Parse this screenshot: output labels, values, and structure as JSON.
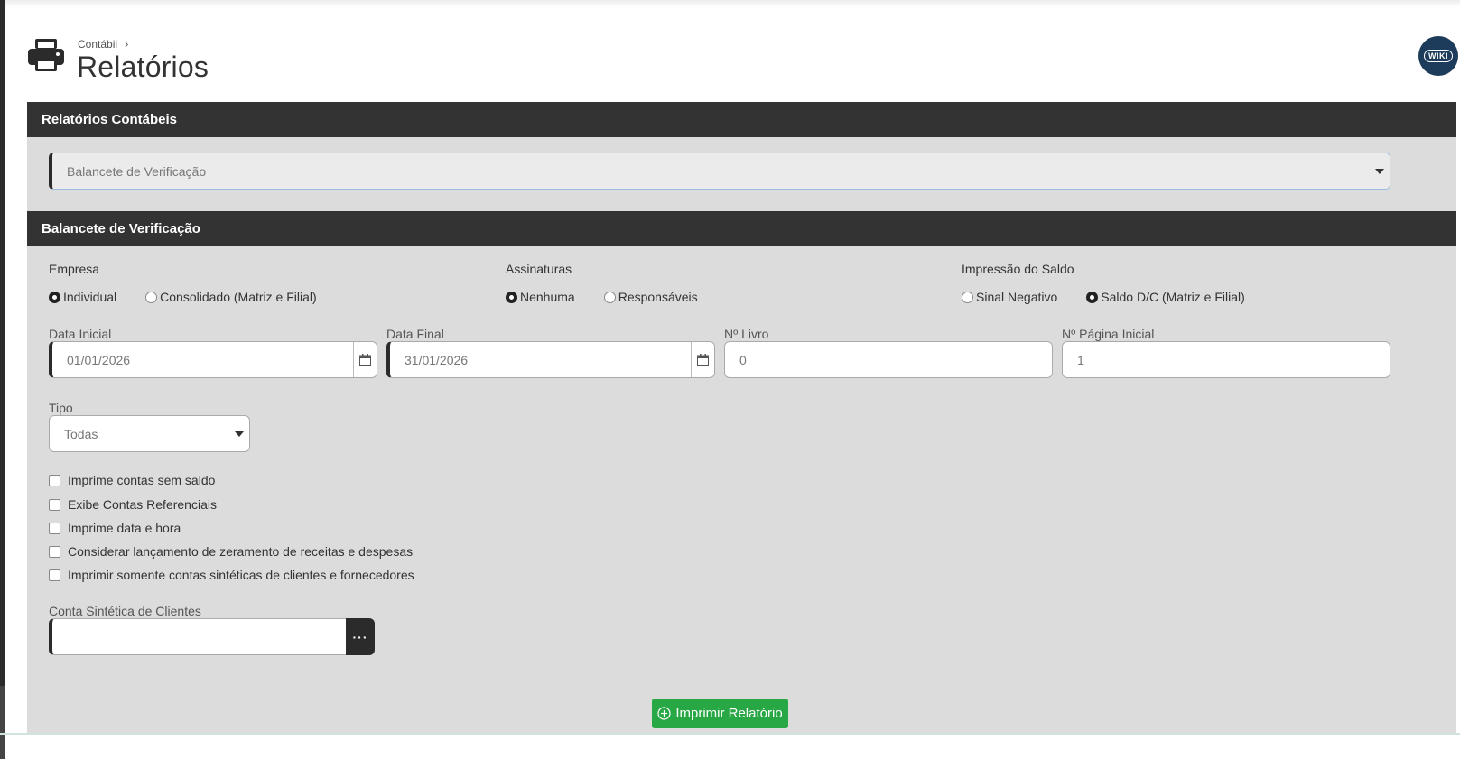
{
  "breadcrumb": {
    "parent": "Contábil"
  },
  "page": {
    "title": "Relatórios",
    "wiki_badge": "WIKI"
  },
  "report_section": {
    "title": "Relatórios Contábeis",
    "selected_report": "Balancete de Verificação"
  },
  "balancete": {
    "title": "Balancete de Verificação",
    "empresa": {
      "label": "Empresa",
      "options": [
        "Individual",
        "Consolidado (Matriz e Filial)"
      ],
      "selected": "Individual"
    },
    "assinaturas": {
      "label": "Assinaturas",
      "options": [
        "Nenhuma",
        "Responsáveis"
      ],
      "selected": "Nenhuma"
    },
    "impressao_saldo": {
      "label": "Impressão do Saldo",
      "options": [
        "Sinal Negativo",
        "Saldo D/C (Matriz e Filial)"
      ],
      "selected": "Saldo D/C (Matriz e Filial)"
    },
    "data_inicial": {
      "label": "Data Inicial",
      "value": "01/01/2026"
    },
    "data_final": {
      "label": "Data Final",
      "value": "31/01/2026"
    },
    "n_livro": {
      "label": "Nº Livro",
      "value": "0"
    },
    "n_pagina_inicial": {
      "label": "Nº Página Inicial",
      "value": "1"
    },
    "tipo": {
      "label": "Tipo",
      "value": "Todas"
    },
    "checkboxes": [
      {
        "label": "Imprime contas sem saldo",
        "checked": false
      },
      {
        "label": "Exibe Contas Referenciais",
        "checked": false
      },
      {
        "label": "Imprime data e hora",
        "checked": false
      },
      {
        "label": "Considerar lançamento de zeramento de receitas e despesas",
        "checked": false
      },
      {
        "label": "Imprimir somente contas sintéticas de clientes e fornecedores",
        "checked": false
      }
    ],
    "conta_sintetica_clientes": {
      "label": "Conta Sintética de Clientes",
      "value": "",
      "lookup_button": "···"
    },
    "print_button": "Imprimir Relatório"
  },
  "colors": {
    "header_bar": "#333333",
    "panel_bg": "#dcdcdc",
    "print_button": "#28a745",
    "wiki_badge": "#1d3b5a"
  }
}
